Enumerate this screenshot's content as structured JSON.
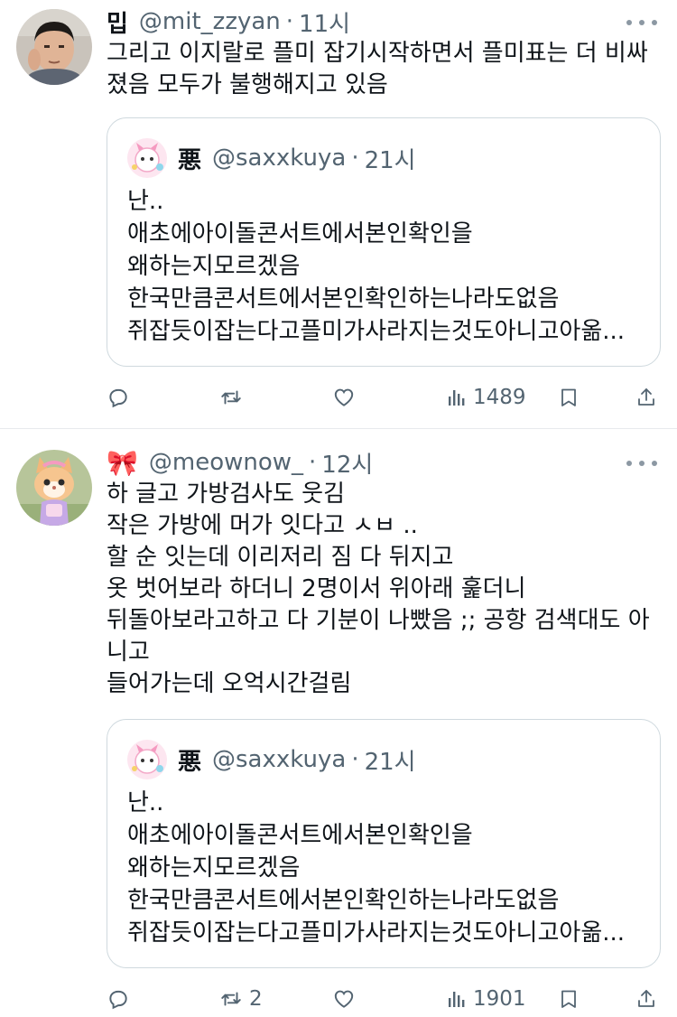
{
  "tweets": [
    {
      "name": "밉",
      "handle": "@mit_zzyan",
      "dot": "·",
      "time": "11시",
      "text": "그리고 이지랄로 플미 잡기시작하면서 플미표는 더 비싸\n졌음 모두가 불행해지고 있음",
      "quote": {
        "name": "悪",
        "handle": "@saxxkuya",
        "dot": "·",
        "time": "21시",
        "text": "난..\n애초에아이돌콘서트에서본인확인을\n왜하는지모르겠음\n한국만큼콘서트에서본인확인하는나라도없음\n쥐잡듯이잡는다고플미가사라지는것도아니고아옮..."
      },
      "actions": {
        "reply": "",
        "retweet": "",
        "like": "",
        "views": "1489"
      }
    },
    {
      "name": "🎀",
      "handle": "@meownow_",
      "dot": "·",
      "time": "12시",
      "text": "하 글고 가방검사도 웃김\n작은 가방에 머가 잇다고 ㅅㅂ ..\n할 순 잇는데 이리저리 짐 다 뒤지고\n옷 벗어보라 하더니 2명이서 위아래 훑더니\n뒤돌아보라고하고 다 기분이 나빴음 ;; 공항 검색대도 아\n니고\n들어가는데 오억시간걸림",
      "quote": {
        "name": "悪",
        "handle": "@saxxkuya",
        "dot": "·",
        "time": "21시",
        "text": "난..\n애초에아이돌콘서트에서본인확인을\n왜하는지모르겠음\n한국만큼콘서트에서본인확인하는나라도없음\n쥐잡듯이잡는다고플미가사라지는것도아니고아옮..."
      },
      "actions": {
        "reply": "",
        "retweet": "2",
        "like": "",
        "views": "1901"
      }
    }
  ],
  "colors": {
    "text": "#0f1419",
    "secondary": "#536471",
    "border": "#cfd9de"
  }
}
